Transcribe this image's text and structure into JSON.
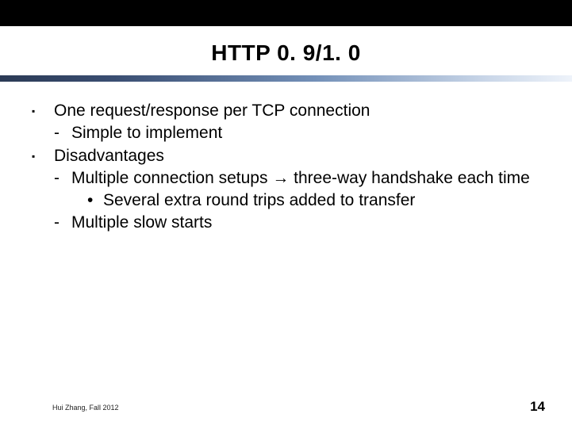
{
  "title": "HTTP 0. 9/1. 0",
  "bullets": {
    "b1a": "One request/response per TCP connection",
    "b1a_s1": "Simple to implement",
    "b1b": "Disadvantages",
    "b1b_s1": "Multiple connection setups → three-way handshake each time",
    "b1b_s1_s1": "Several extra round trips added to transfer",
    "b1b_s2": "Multiple slow starts"
  },
  "marks": {
    "level1": "▪",
    "level2": "-",
    "level3": "•"
  },
  "footer": {
    "left": "Hui Zhang, Fall 2012",
    "page": "14"
  }
}
